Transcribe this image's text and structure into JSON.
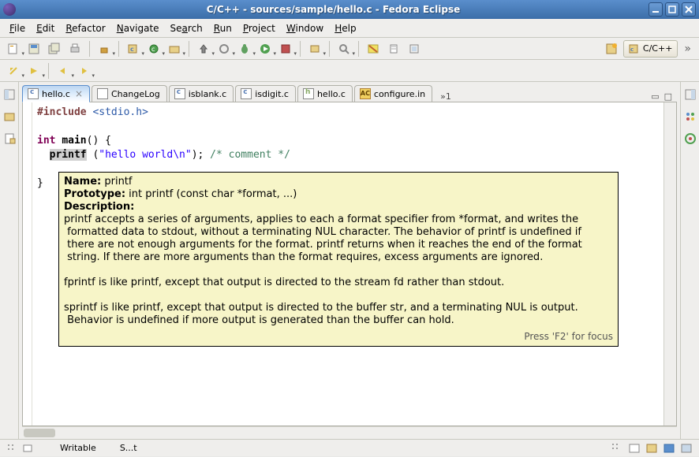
{
  "window": {
    "title": "C/C++ - sources/sample/hello.c - Fedora Eclipse"
  },
  "menus": [
    "File",
    "Edit",
    "Refactor",
    "Navigate",
    "Search",
    "Run",
    "Project",
    "Window",
    "Help"
  ],
  "perspective": {
    "name": "C/C++"
  },
  "tabs": [
    {
      "label": "hello.c",
      "icon": "c",
      "active": true,
      "closable": true
    },
    {
      "label": "ChangeLog",
      "icon": "chg",
      "active": false
    },
    {
      "label": "isblank.c",
      "icon": "c",
      "active": false
    },
    {
      "label": "isdigit.c",
      "icon": "c",
      "active": false
    },
    {
      "label": "hello.c",
      "icon": "h",
      "active": false
    },
    {
      "label": "configure.in",
      "icon": "ac",
      "active": false
    }
  ],
  "more_tabs_indicator": "»1",
  "code": {
    "include_directive": "#include",
    "include_header": "<stdio.h>",
    "kw_int": "int",
    "fn_main": "main",
    "main_sig_rest": "() {",
    "printf": "printf",
    "call_tail": " (\"hello world\\n\"); ",
    "comment": "/* comment */",
    "close_brace": "}"
  },
  "tooltip": {
    "name_label": "Name:",
    "name_value": "printf",
    "proto_label": "Prototype:",
    "proto_value": "int printf (const char *format, ...)",
    "desc_label": "Description:",
    "desc_body": "printf accepts a series of arguments, applies to each a format specifier from *format, and writes the\n formatted data to stdout, without a terminating NUL character. The behavior of printf is undefined if\n there are not enough arguments for the format. printf returns when it reaches the end of the format\n string. If there are more arguments than the format requires, excess arguments are ignored.\n\nfprintf is like printf, except that output is directed to the stream fd rather than stdout.\n\nsprintf is like printf, except that output is directed to the buffer str, and a terminating NUL is output.\n Behavior is undefined if more output is generated than the buffer can hold.",
    "footer": "Press 'F2' for focus"
  },
  "status": {
    "field1": "Writable",
    "field2": "S...t"
  }
}
